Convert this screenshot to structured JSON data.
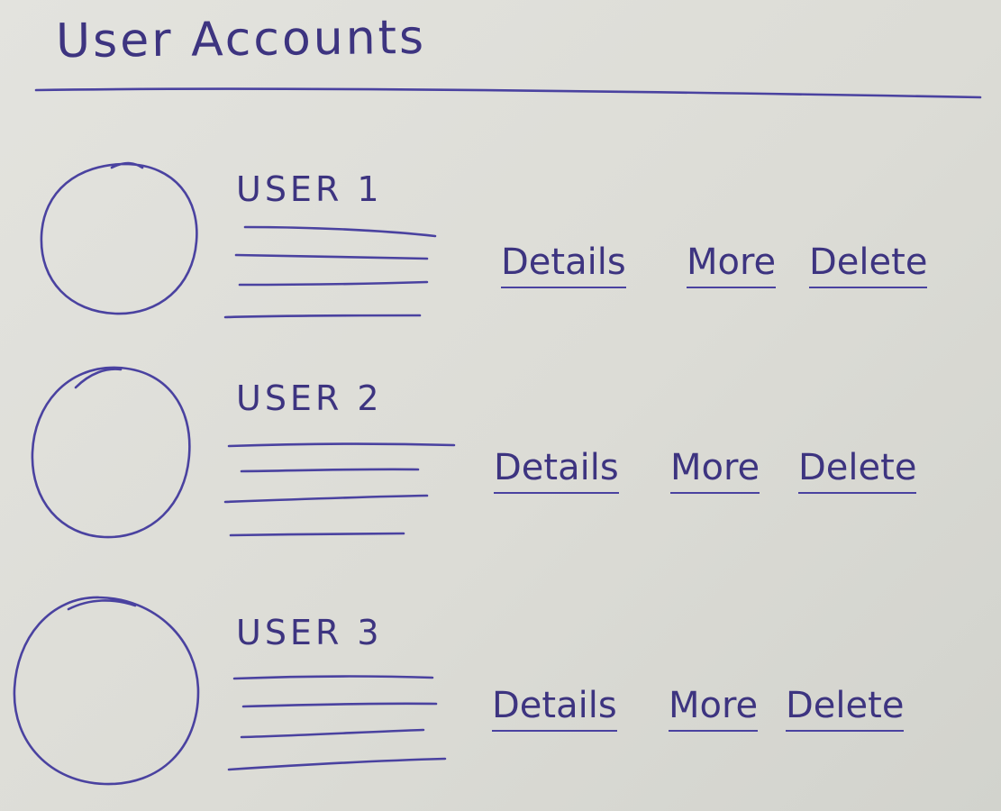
{
  "header": {
    "title": "User Accounts"
  },
  "users": [
    {
      "name": "USER 1",
      "actions": {
        "details": "Details",
        "more": "More",
        "delete": "Delete"
      }
    },
    {
      "name": "USER 2",
      "actions": {
        "details": "Details",
        "more": "More",
        "delete": "Delete"
      }
    },
    {
      "name": "USER 3",
      "actions": {
        "details": "Details",
        "more": "More",
        "delete": "Delete"
      }
    }
  ],
  "colors": {
    "ink": "#3d3480",
    "paper": "#dedfd9"
  }
}
